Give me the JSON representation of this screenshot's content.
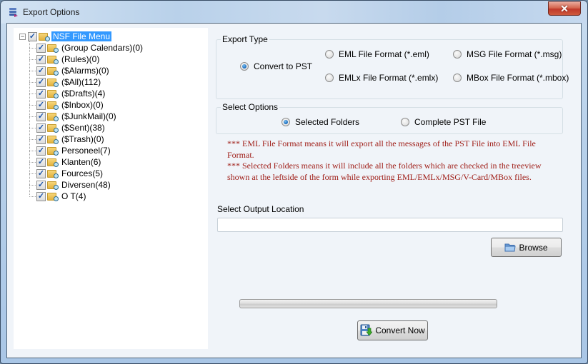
{
  "window": {
    "title": "Export Options",
    "close_glyph": "✕"
  },
  "tree": {
    "root": {
      "label": "NSF File Menu",
      "checked": true,
      "expanded": true,
      "selected": true,
      "expander_glyph": "−"
    },
    "items": [
      {
        "label": "(Group Calendars)(0)",
        "checked": true
      },
      {
        "label": "(Rules)(0)",
        "checked": true
      },
      {
        "label": "($Alarms)(0)",
        "checked": true
      },
      {
        "label": "($All)(112)",
        "checked": true
      },
      {
        "label": "($Drafts)(4)",
        "checked": true
      },
      {
        "label": "($Inbox)(0)",
        "checked": true
      },
      {
        "label": "($JunkMail)(0)",
        "checked": true
      },
      {
        "label": "($Sent)(38)",
        "checked": true
      },
      {
        "label": "($Trash)(0)",
        "checked": true
      },
      {
        "label": "Personeel(7)",
        "checked": true
      },
      {
        "label": "Klanten(6)",
        "checked": true
      },
      {
        "label": "Fources(5)",
        "checked": true
      },
      {
        "label": "Diversen(48)",
        "checked": true
      },
      {
        "label": "O T(4)",
        "checked": true
      }
    ],
    "check_glyph": "✓"
  },
  "export_type": {
    "title": "Export Type",
    "options": [
      {
        "label": "Convert to PST",
        "checked": true
      },
      {
        "label": "EML File  Format (*.eml)",
        "checked": false
      },
      {
        "label": "MSG File Format (*.msg)",
        "checked": false
      },
      {
        "label": "EMLx File  Format (*.emlx)",
        "checked": false
      },
      {
        "label": "MBox File Format (*.mbox)",
        "checked": false
      }
    ]
  },
  "select_options": {
    "title": "Select Options",
    "options": [
      {
        "label": "Selected Folders",
        "checked": true
      },
      {
        "label": "Complete PST File",
        "checked": false
      }
    ]
  },
  "notes": [
    "*** EML File Format means it will export all the messages of the PST File into EML File Format.",
    "*** Selected Folders means it will include all the folders which are checked in the treeview shown at the leftside of the form while exporting EML/EMLx/MSG/V-Card/MBox files."
  ],
  "output": {
    "label": "Select Output Location",
    "value": "",
    "placeholder": ""
  },
  "buttons": {
    "browse": "Browse",
    "convert": "Convert Now"
  },
  "progress": {
    "value_percent": 0
  },
  "colors": {
    "note_text": "#a0201a",
    "selection": "#3399ff",
    "close_button": "#c0392b"
  }
}
